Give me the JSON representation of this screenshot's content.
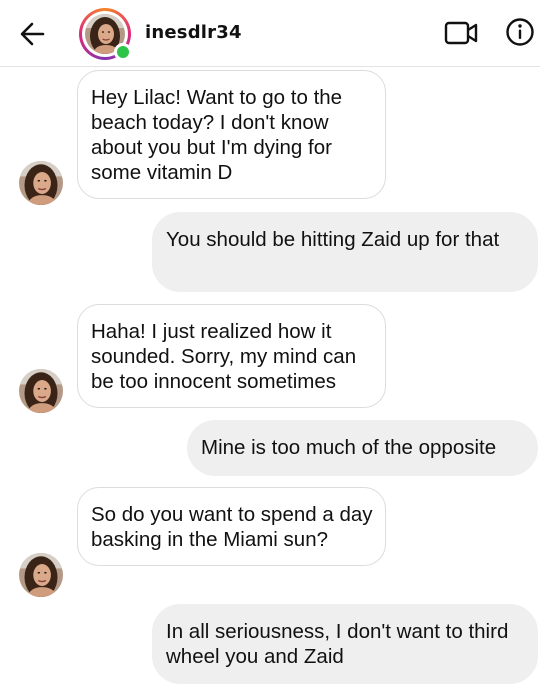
{
  "header": {
    "username": "inesdlr34",
    "back_icon": "arrow-left-icon",
    "video_icon": "video-camera-icon",
    "info_icon": "info-icon",
    "online_color": "#2ec44a"
  },
  "messages": [
    {
      "direction": "incoming",
      "text": "Hey Lilac! Want to go to the beach today? I don't know about you but I'm dying for some vitamin D"
    },
    {
      "direction": "outgoing",
      "text": "You should be hitting Zaid up for that"
    },
    {
      "direction": "incoming",
      "text": "Haha! I just realized how it sounded. Sorry, my mind can be too innocent sometimes"
    },
    {
      "direction": "outgoing",
      "text": "Mine is too much of the opposite"
    },
    {
      "direction": "incoming",
      "text": "So do you want to spend a day basking in the Miami sun?"
    },
    {
      "direction": "outgoing",
      "text": "In all seriousness, I don't want to third wheel you and Zaid"
    }
  ]
}
